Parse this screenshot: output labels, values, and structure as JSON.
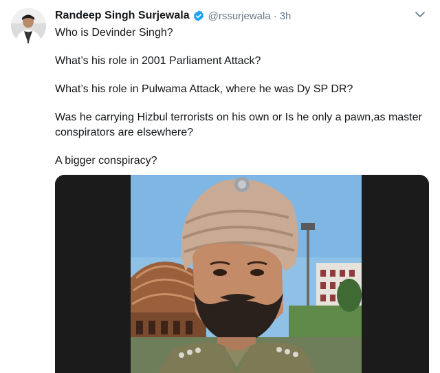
{
  "tweet": {
    "display_name": "Randeep Singh Surjewala",
    "handle": "@rssurjewala",
    "separator": "·",
    "time": "3h",
    "lines": [
      "Who is Devinder Singh?",
      "What’s his role in 2001 Parliament Attack?",
      "What’s his role in Pulwama Attack, where he was Dy SP DR?",
      "Was he carrying Hizbul terrorists on his own or Is he only a pawn,as master conspirators are elsewhere?",
      "A bigger conspiracy?"
    ]
  },
  "icons": {
    "verified": "verified-badge-icon",
    "caret": "chevron-down-icon"
  },
  "colors": {
    "verified": "#1da1f2",
    "secondary_text": "#657786",
    "primary_text": "#14171a"
  }
}
